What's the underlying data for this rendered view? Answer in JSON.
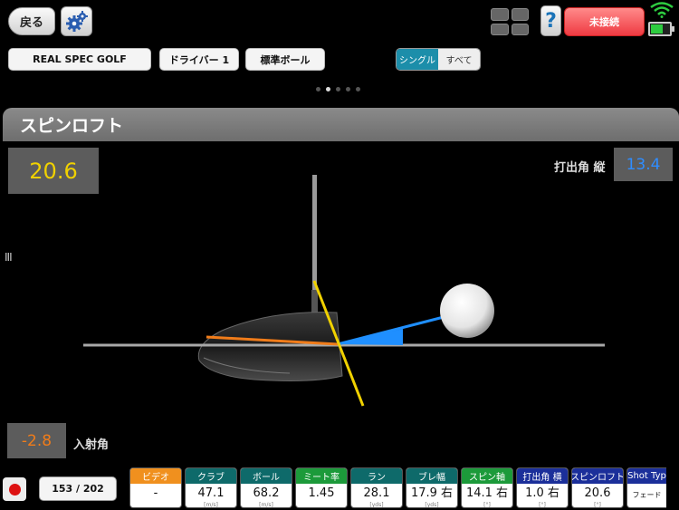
{
  "top": {
    "back_label": "戻る",
    "connection_label": "未接続",
    "help_label": "?"
  },
  "pills": {
    "brand": "REAL SPEC GOLF",
    "club": "ドライバー 1",
    "ball": "標準ボール"
  },
  "toggle": {
    "single": "シングル",
    "all": "すべて",
    "selected": "single"
  },
  "page": {
    "current": 2,
    "total": 5
  },
  "panel": {
    "title": "スピンロフト",
    "spin_loft_value": "20.6",
    "launch_vertical_label": "打出角 縦",
    "launch_vertical_value": "13.4",
    "attack_angle_value": "-2.8",
    "attack_angle_label": "入射角",
    "side_mark": "III"
  },
  "bottom": {
    "counter": "153 / 202",
    "stats": [
      {
        "label": "ビデオ",
        "value": "-",
        "unit": "",
        "color": "#f0901e"
      },
      {
        "label": "クラブ",
        "value": "47.1",
        "unit": "[m/s]",
        "color": "#0e6a6a"
      },
      {
        "label": "ボール",
        "value": "68.2",
        "unit": "[m/s]",
        "color": "#0e6a6a"
      },
      {
        "label": "ミート率",
        "value": "1.45",
        "unit": "",
        "color": "#1c9a3a"
      },
      {
        "label": "ラン",
        "value": "28.1",
        "unit": "[yds]",
        "color": "#0e6a6a"
      },
      {
        "label": "ブレ幅",
        "value": "17.9 右",
        "unit": "[yds]",
        "color": "#0e6a6a"
      },
      {
        "label": "スピン軸",
        "value": "14.1 右",
        "unit": "[°]",
        "color": "#1c9a3a"
      },
      {
        "label": "打出角 横",
        "value": "1.0 右",
        "unit": "[°]",
        "color": "#1b2f9a"
      },
      {
        "label": "スピンロフト",
        "value": "20.6",
        "unit": "[°]",
        "color": "#1b2f9a"
      },
      {
        "label": "Shot Typ",
        "value": "フェード",
        "unit": "",
        "color": "#1b2f9a"
      }
    ]
  },
  "colors": {
    "spin_loft": "#f0d100",
    "launch": "#2f8dff",
    "attack": "#f07c1a",
    "connection": "#ef3a42"
  }
}
